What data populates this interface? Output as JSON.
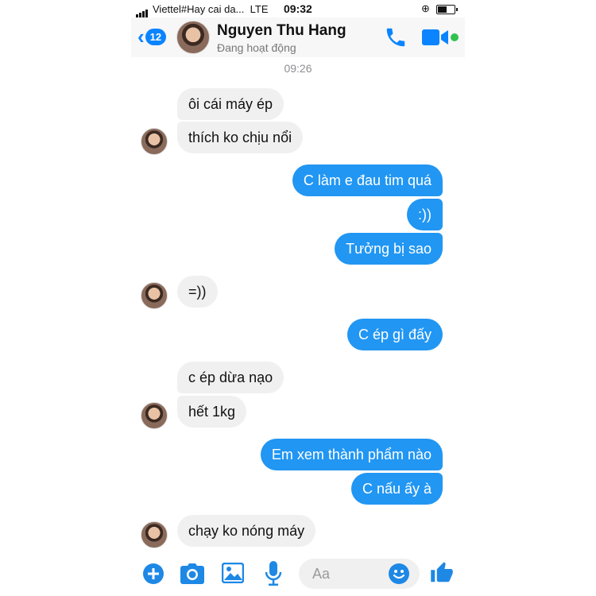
{
  "status_bar": {
    "carrier": "Viettel#Hay cai da...",
    "network": "LTE",
    "time": "09:32"
  },
  "header": {
    "back_count": "12",
    "contact_name": "Nguyen Thu Hang",
    "contact_status": "Đang hoạt động"
  },
  "timestamp": "09:26",
  "messages": [
    {
      "side": "incoming",
      "text": "ôi cái máy ép"
    },
    {
      "side": "incoming",
      "text": "thích ko chịu nổi"
    },
    {
      "side": "outgoing",
      "text": "C làm e đau tim quá"
    },
    {
      "side": "outgoing",
      "text": ":))"
    },
    {
      "side": "outgoing",
      "text": "Tưởng bị sao"
    },
    {
      "side": "incoming",
      "text": "=))"
    },
    {
      "side": "outgoing",
      "text": "C ép gì đấy"
    },
    {
      "side": "incoming",
      "text": "c ép dừa nạo"
    },
    {
      "side": "incoming",
      "text": "hết 1kg"
    },
    {
      "side": "outgoing",
      "text": "Em xem thành phẩm nào"
    },
    {
      "side": "outgoing",
      "text": "C nấu ấy à"
    },
    {
      "side": "incoming",
      "text": "chạy ko nóng máy"
    }
  ],
  "composer": {
    "placeholder": "Aa"
  },
  "colors": {
    "accent": "#0a84ff",
    "outgoing_bubble": "#2196f3",
    "incoming_bubble": "#f0f0f0",
    "online": "#31c24d"
  },
  "icons": [
    "back-chevron-icon",
    "phone-icon",
    "video-camera-icon",
    "plus-icon",
    "camera-icon",
    "gallery-icon",
    "microphone-icon",
    "emoji-icon",
    "thumbs-up-icon"
  ]
}
